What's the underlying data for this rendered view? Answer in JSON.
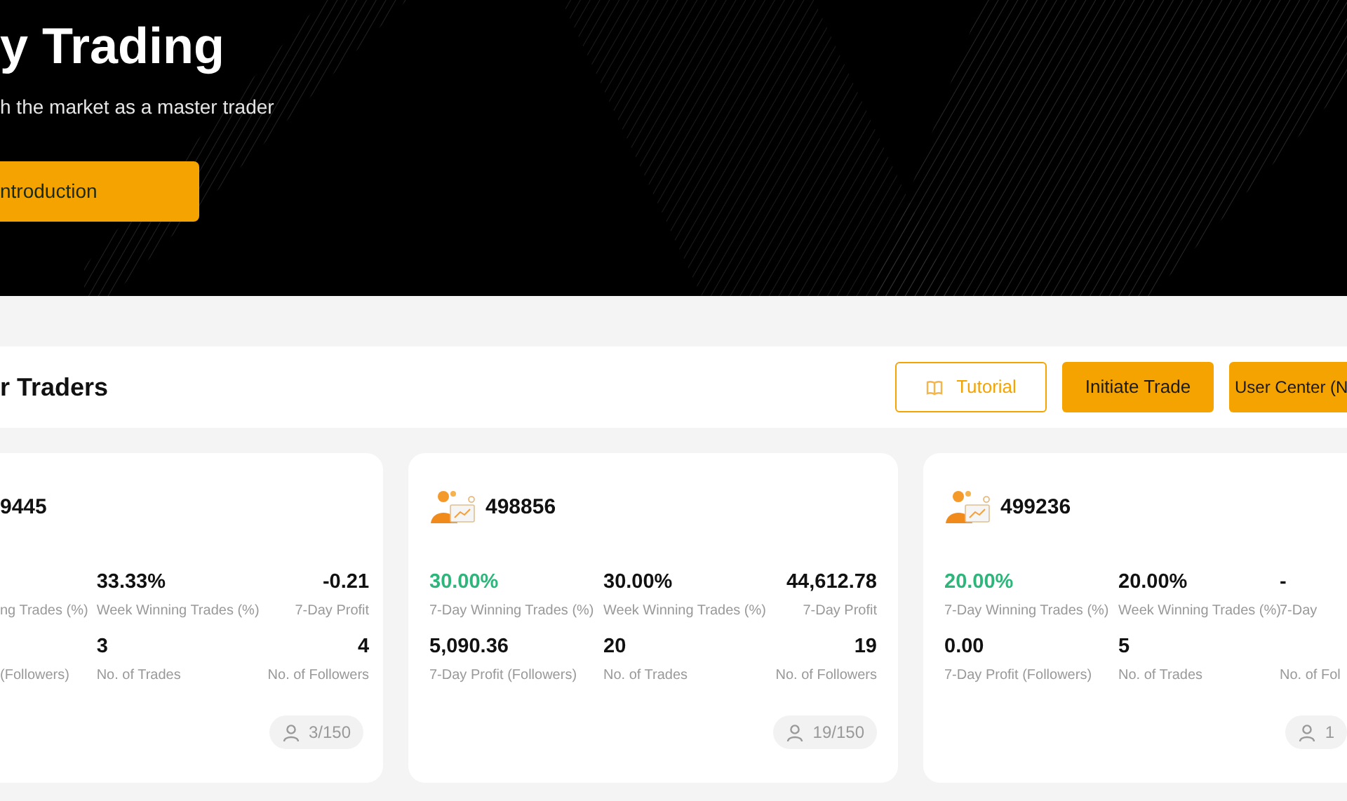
{
  "hero": {
    "title": "y Trading",
    "subtitle": "h the market as a master trader",
    "button": "ntroduction"
  },
  "toolbar": {
    "title": "r Traders",
    "buttons": [
      {
        "label": "Tutorial",
        "kind": "outline"
      },
      {
        "label": "Initiate Trade",
        "kind": "solid"
      },
      {
        "label": "User Center (N",
        "kind": "solid"
      }
    ]
  },
  "cards": [
    {
      "id": "9445",
      "avatar": false,
      "stats": [
        {
          "label": "ng Trades (%)"
        },
        {
          "value": "33.33%",
          "label": "Week Winning Trades (%)",
          "highlight": false
        },
        {
          "value": "-0.21",
          "label": "7-Day Profit",
          "highlight": false
        },
        {
          "label": "(Followers)"
        },
        {
          "value": "3",
          "label": "No. of Trades",
          "highlight": false
        },
        {
          "value": "4",
          "label": "No. of Followers",
          "highlight": false
        }
      ],
      "followers": "3/150"
    },
    {
      "id": "498856",
      "avatar": true,
      "stats": [
        {
          "value": "30.00%",
          "label": "7-Day Winning Trades (%)",
          "highlight": true
        },
        {
          "value": "30.00%",
          "label": "Week Winning Trades (%)",
          "highlight": false
        },
        {
          "value": "44,612.78",
          "label": "7-Day Profit",
          "highlight": false
        },
        {
          "value": "5,090.36",
          "label": "7-Day Profit (Followers)",
          "highlight": false
        },
        {
          "value": "20",
          "label": "No. of Trades",
          "highlight": false
        },
        {
          "value": "19",
          "label": "No. of Followers",
          "highlight": false
        }
      ],
      "followers": "19/150"
    },
    {
      "id": "499236",
      "avatar": true,
      "stats": [
        {
          "value": "20.00%",
          "label": "7-Day Winning Trades (%)",
          "highlight": true
        },
        {
          "value": "20.00%",
          "label": "Week Winning Trades (%)",
          "highlight": false
        },
        {
          "value": "-",
          "label": "7-Day",
          "highlight": false
        },
        {
          "value": "0.00",
          "label": "7-Day Profit (Followers)",
          "highlight": false
        },
        {
          "value": "5",
          "label": "No. of Trades",
          "highlight": false
        },
        {
          "label": "No. of Fol"
        }
      ],
      "followers": "1"
    }
  ]
}
